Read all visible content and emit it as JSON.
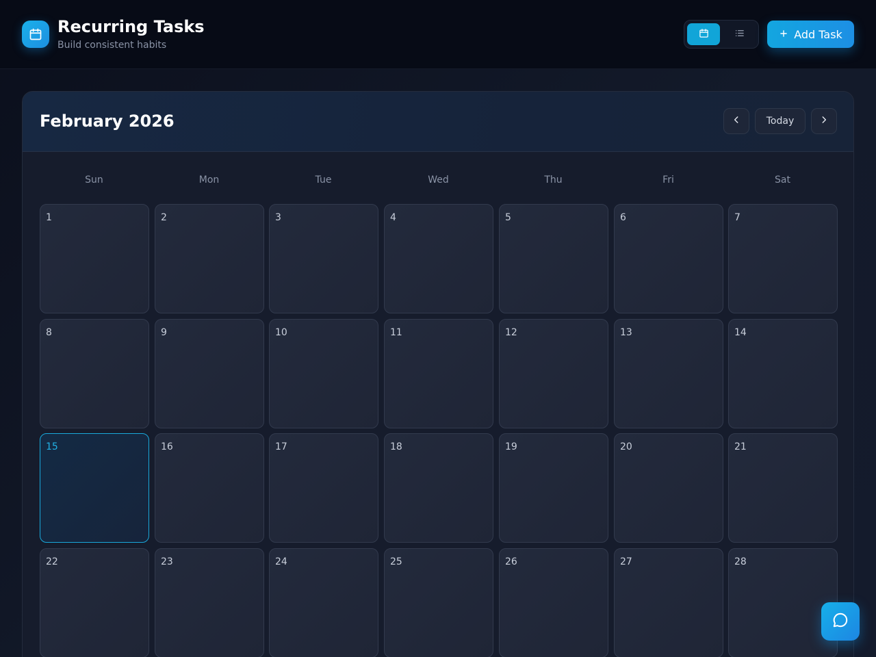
{
  "header": {
    "title": "Recurring Tasks",
    "subtitle": "Build consistent habits",
    "app_icon": "calendar-icon",
    "view_toggle": {
      "active": "calendar-icon",
      "inactive": "list-icon"
    },
    "add_task_label": "Add Task",
    "add_task_icon": "plus-icon"
  },
  "calendar": {
    "month_title": "February 2026",
    "prev_icon": "chevron-left-icon",
    "today_label": "Today",
    "next_icon": "chevron-right-icon",
    "weekdays": [
      "Sun",
      "Mon",
      "Tue",
      "Wed",
      "Thu",
      "Fri",
      "Sat"
    ],
    "days": [
      "1",
      "2",
      "3",
      "4",
      "5",
      "6",
      "7",
      "8",
      "9",
      "10",
      "11",
      "12",
      "13",
      "14",
      "15",
      "16",
      "17",
      "18",
      "19",
      "20",
      "21",
      "22",
      "23",
      "24",
      "25",
      "26",
      "27",
      "28"
    ],
    "today": "15"
  },
  "chat": {
    "icon": "chat-bubble-icon"
  },
  "colors": {
    "accent": "#13a6e0",
    "background": "#0f1422",
    "header_bg": "#070b16",
    "cell_bg": "#232a3c",
    "today_border": "#19a9dc"
  }
}
